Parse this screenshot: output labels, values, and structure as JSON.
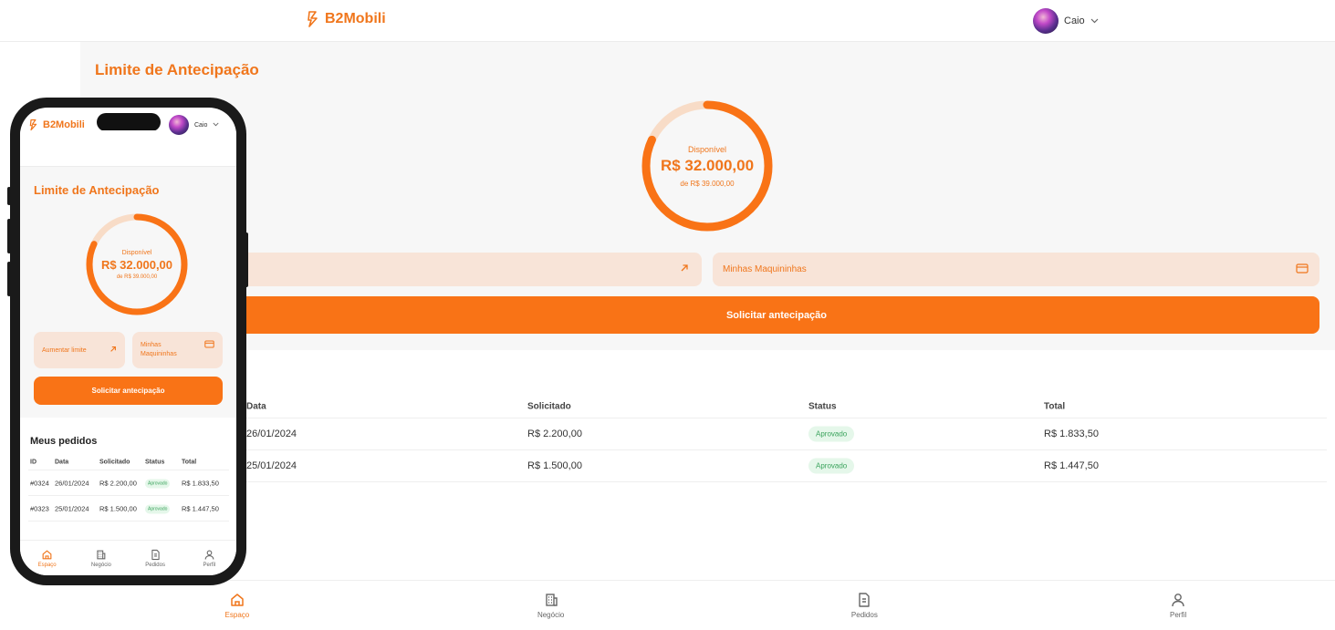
{
  "brand": {
    "name": "B2Mobili",
    "accent": "#f97316"
  },
  "user": {
    "name": "Caio"
  },
  "page": {
    "title": "Limite de Antecipação"
  },
  "limit": {
    "label": "Disponível",
    "available": "R$ 32.000,00",
    "total": "de R$ 39.000,00",
    "available_fraction": 0.82
  },
  "actions": {
    "increase_limit": "Aumentar limite",
    "machines": "Minhas Maquininhas",
    "request": "Solicitar antecipação"
  },
  "orders": {
    "title": "Meus pedidos",
    "columns": [
      "ID",
      "Data",
      "Solicitado",
      "Status",
      "Total"
    ],
    "rows": [
      {
        "id": "#0324",
        "date": "26/01/2024",
        "requested": "R$ 2.200,00",
        "status": "Aprovado",
        "total": "R$ 1.833,50"
      },
      {
        "id": "#0323",
        "date": "25/01/2024",
        "requested": "R$ 1.500,00",
        "status": "Aprovado",
        "total": "R$ 1.447,50"
      }
    ]
  },
  "nav": {
    "items": [
      {
        "label": "Espaço",
        "icon": "home-icon",
        "active": true
      },
      {
        "label": "Negócio",
        "icon": "building-icon",
        "active": false
      },
      {
        "label": "Pedidos",
        "icon": "document-icon",
        "active": false
      },
      {
        "label": "Perfil",
        "icon": "user-icon",
        "active": false
      }
    ]
  }
}
